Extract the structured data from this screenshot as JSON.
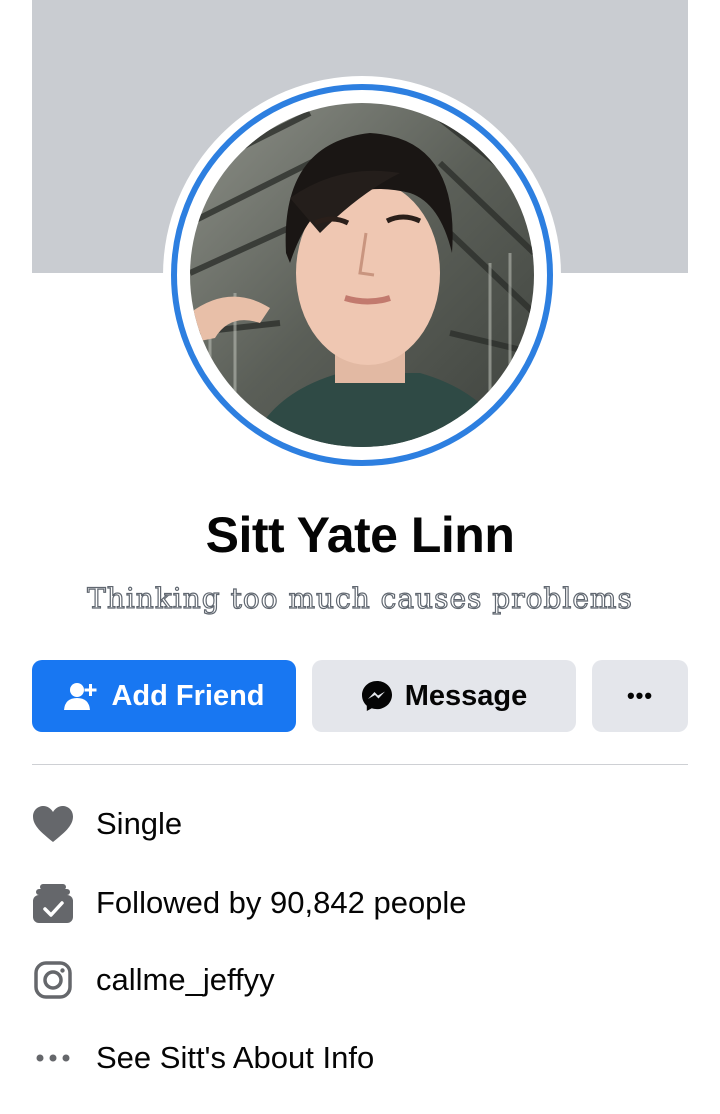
{
  "profile": {
    "name": "Sitt Yate Linn",
    "bio": "Thinking too much causes problems"
  },
  "actions": {
    "add_friend": "Add Friend",
    "message": "Message",
    "more": "•••"
  },
  "intro": [
    {
      "icon": "heart-icon",
      "text": "Single"
    },
    {
      "icon": "followers-icon",
      "text": "Followed by 90,842 people"
    },
    {
      "icon": "instagram-icon",
      "text": "callme_jeffyy"
    },
    {
      "icon": "more-dots-icon",
      "text": "See Sitt's About Info"
    }
  ],
  "colors": {
    "accent": "#1877f2",
    "story_ring": "#2d7fe0",
    "cover": "#c9ccd1",
    "secondary_button": "#e4e6eb",
    "icon_gray": "#65676b"
  }
}
